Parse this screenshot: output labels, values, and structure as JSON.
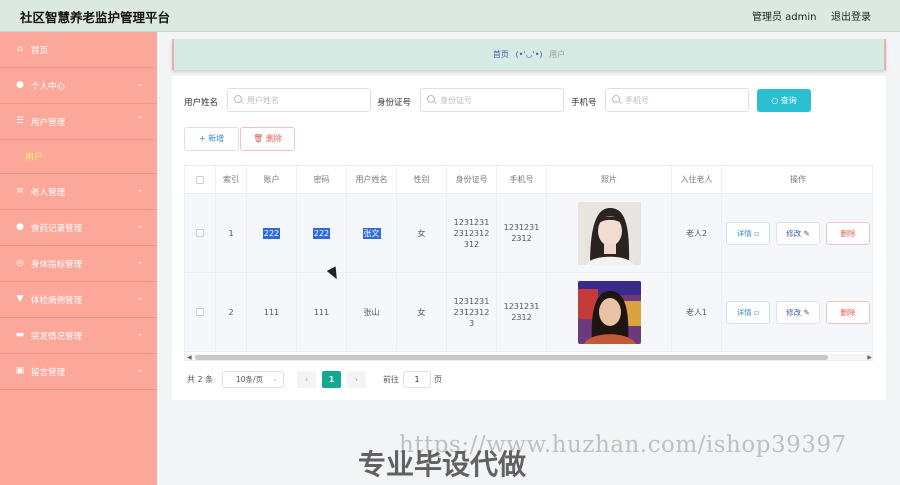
{
  "header": {
    "title": "社区智慧养老监护管理平台",
    "user": "管理员 admin",
    "logout": "退出登录"
  },
  "sidebar": {
    "items": [
      {
        "label": "首页",
        "icon": "home-icon"
      },
      {
        "label": "个人中心",
        "icon": "person-icon"
      },
      {
        "label": "用户管理",
        "icon": "sliders-icon",
        "submenu": "用户"
      },
      {
        "label": "老人管理",
        "icon": "list-icon"
      },
      {
        "label": "食药记录管理",
        "icon": "person-icon"
      },
      {
        "label": "身体指标管理",
        "icon": "globe-icon"
      },
      {
        "label": "体检病例管理",
        "icon": "dashboard-icon"
      },
      {
        "label": "突发情况管理",
        "icon": "briefcase-icon"
      },
      {
        "label": "留言管理",
        "icon": "clipboard-icon"
      }
    ]
  },
  "breadcrumb": {
    "home": "首页",
    "emoticon": "(•'◡'•)",
    "current": "用户"
  },
  "search": {
    "name_label": "用户姓名",
    "name_placeholder": "用户姓名",
    "id_label": "身份证号",
    "id_placeholder": "身份证号",
    "phone_label": "手机号",
    "phone_placeholder": "手机号",
    "button": "查询"
  },
  "actions": {
    "add": "新增",
    "delete": "删除"
  },
  "table": {
    "headers": [
      "索引",
      "账户",
      "密码",
      "用户姓名",
      "性别",
      "身份证号",
      "手机号",
      "照片",
      "入住老人",
      "操作"
    ],
    "rows": [
      {
        "index": "1",
        "account": "222",
        "password": "222",
        "name": "张文",
        "gender": "女",
        "id_line1": "1231231",
        "id_line2": "2312312",
        "id_line3": "312",
        "phone_line1": "1231231",
        "phone_line2": "2312",
        "elder": "老人2"
      },
      {
        "index": "2",
        "account": "111",
        "password": "111",
        "name": "张山",
        "gender": "女",
        "id_line1": "1231231",
        "id_line2": "2312312",
        "id_line3": "3",
        "phone_line1": "1231231",
        "phone_line2": "2312",
        "elder": "老人1"
      }
    ],
    "op_detail": "详情",
    "op_edit": "修改",
    "op_delete": "删除"
  },
  "pagination": {
    "total": "共 2 条",
    "page_size": "10条/页",
    "current_page": "1",
    "goto_label": "前往",
    "goto_value": "1",
    "page_suffix": "页"
  },
  "watermark": {
    "url": "https://www.huzhan.com/ishop39397",
    "text": "专业毕设代做"
  },
  "colors": {
    "sidebar": "#fba79a",
    "header": "#dbe9e1",
    "accent": "#2ac0d2",
    "pager_active": "#14a88f"
  }
}
